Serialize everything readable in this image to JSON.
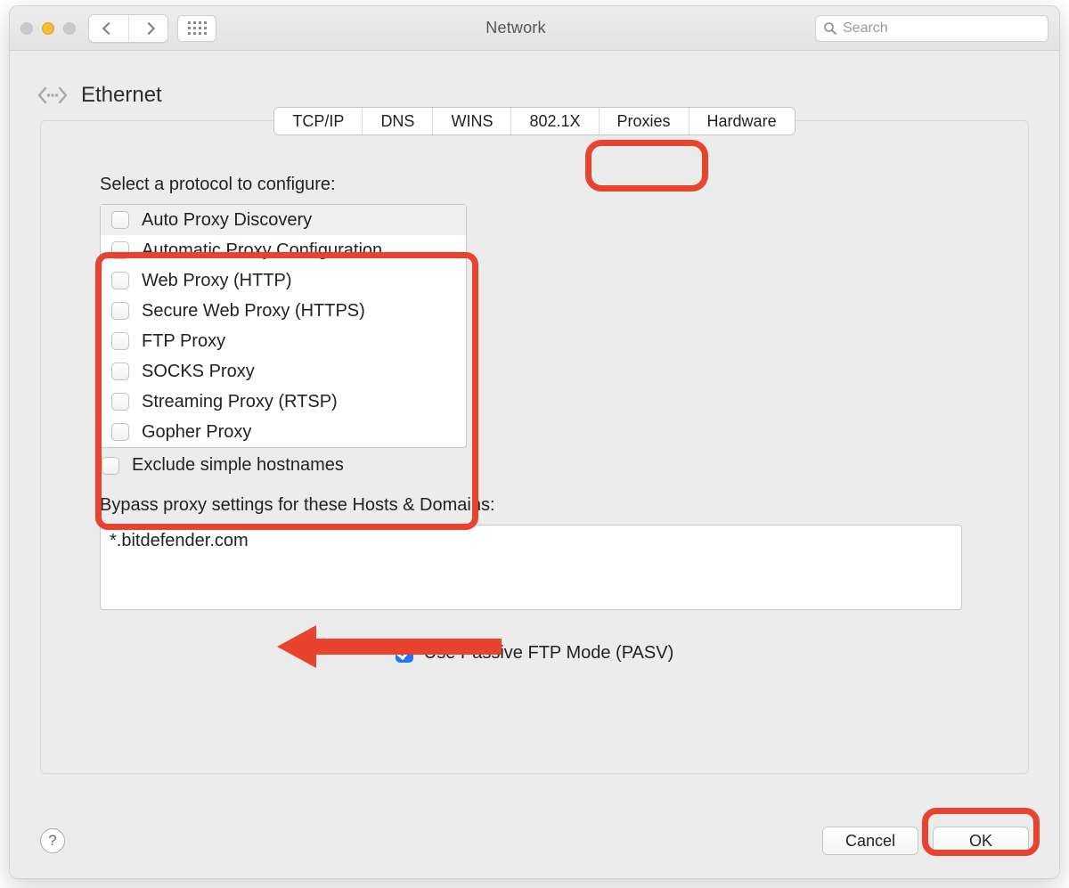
{
  "window_title": "Network",
  "search_placeholder": "Search",
  "interface": "Ethernet",
  "tabs": [
    "TCP/IP",
    "DNS",
    "WINS",
    "802.1X",
    "Proxies",
    "Hardware"
  ],
  "selected_tab": "Proxies",
  "protocol_prompt": "Select a protocol to configure:",
  "protocols": [
    "Auto Proxy Discovery",
    "Automatic Proxy Configuration",
    "Web Proxy (HTTP)",
    "Secure Web Proxy (HTTPS)",
    "FTP Proxy",
    "SOCKS Proxy",
    "Streaming Proxy (RTSP)",
    "Gopher Proxy"
  ],
  "exclude_label": "Exclude simple hostnames",
  "bypass_label": "Bypass proxy settings for these Hosts & Domains:",
  "bypass_value": "*.bitdefender.com",
  "pasv_label": "Use Passive FTP Mode (PASV)",
  "pasv_checked": true,
  "buttons": {
    "cancel": "Cancel",
    "ok": "OK"
  },
  "help_symbol": "?",
  "annotation_color": "#e8432f"
}
